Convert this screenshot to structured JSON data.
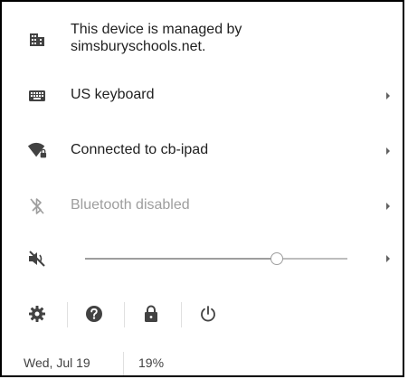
{
  "managed": {
    "line1": "This device is managed by",
    "line2": "simsburyschools.net."
  },
  "keyboard": {
    "label": "US keyboard"
  },
  "network": {
    "label": "Connected to cb-ipad"
  },
  "bluetooth": {
    "label": "Bluetooth disabled"
  },
  "volume": {
    "level": 0.73
  },
  "footer": {
    "date": "Wed, Jul 19",
    "battery": "19%"
  },
  "icons": {
    "managed": "building-icon",
    "keyboard": "keyboard-icon",
    "wifi": "wifi-locked-icon",
    "bluetooth": "bluetooth-disabled-icon",
    "volume": "volume-muted-icon",
    "settings": "gear-icon",
    "help": "help-icon",
    "lock": "lock-icon",
    "power": "power-icon"
  },
  "colors": {
    "text": "#212121",
    "muted": "#9e9e9e",
    "icon": "#424242"
  }
}
